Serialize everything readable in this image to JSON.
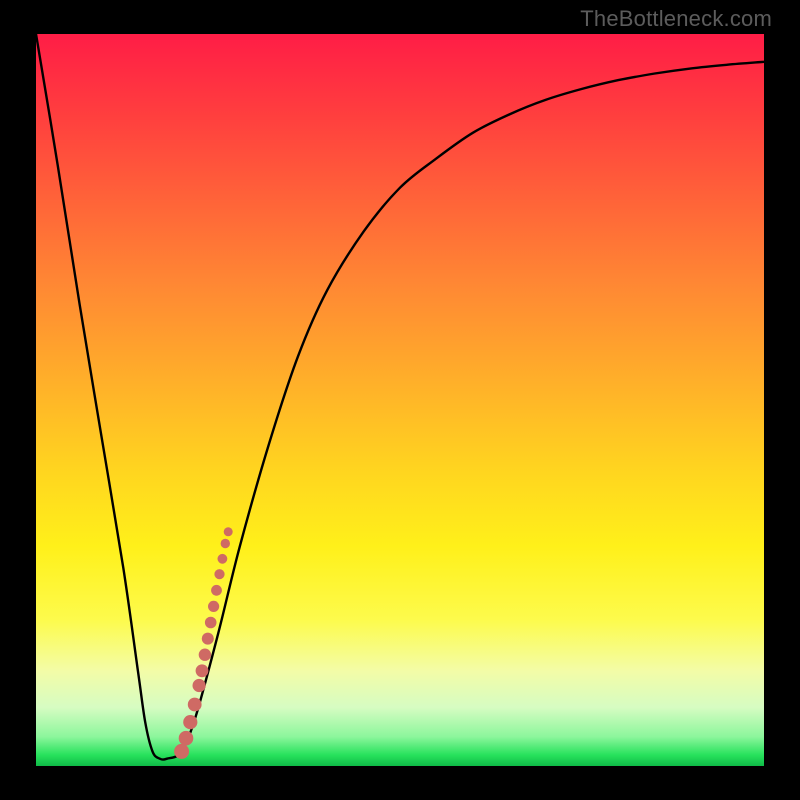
{
  "watermark": "TheBottleneck.com",
  "chart_data": {
    "type": "line",
    "title": "",
    "xlabel": "",
    "ylabel": "",
    "xlim": [
      0,
      100
    ],
    "ylim": [
      0,
      100
    ],
    "grid": false,
    "series": [
      {
        "name": "bottleneck-curve",
        "x": [
          0,
          3,
          6,
          9,
          12,
          14,
          15,
          16,
          17,
          18,
          20,
          22,
          25,
          28,
          32,
          36,
          40,
          45,
          50,
          55,
          60,
          65,
          70,
          75,
          80,
          85,
          90,
          95,
          100
        ],
        "y": [
          100,
          82,
          63,
          45,
          27,
          13,
          6,
          2,
          1,
          1,
          2,
          7,
          18,
          30,
          44,
          56,
          65,
          73,
          79,
          83,
          86.5,
          89,
          91,
          92.5,
          93.7,
          94.6,
          95.3,
          95.8,
          96.2
        ]
      }
    ],
    "overlay": {
      "name": "highlight-range-markers",
      "type": "scatter",
      "color": "#cf6a64",
      "x": [
        20.0,
        20.6,
        21.2,
        21.8,
        22.4,
        22.8,
        23.2,
        23.6,
        24.0,
        24.4,
        24.8,
        25.2,
        25.6,
        26.0,
        26.4
      ],
      "y": [
        2.0,
        3.8,
        6.0,
        8.4,
        11.0,
        13.0,
        15.2,
        17.4,
        19.6,
        21.8,
        24.0,
        26.2,
        28.3,
        30.4,
        32.0
      ]
    }
  }
}
